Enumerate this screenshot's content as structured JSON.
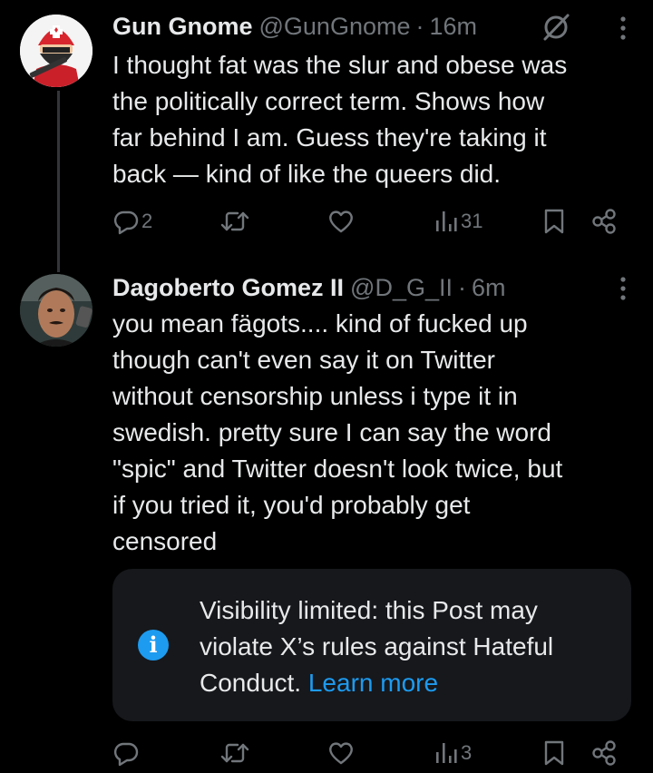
{
  "post1": {
    "name": "Gun Gnome",
    "handle": "@GunGnome",
    "separator": "·",
    "time": "16m",
    "icon_mute": "muted-conversation-icon",
    "icon_more": "more-options-icon",
    "lines": [
      "I thought fat was the slur and obese was",
      "the politically correct term. Shows how",
      "far behind I am. Guess they're taking it",
      "back — kind of like the queers did."
    ],
    "actions": {
      "reply_count": "2",
      "retweet_count": "",
      "like_count": "",
      "views_count": "31"
    }
  },
  "post2": {
    "name": "Dagoberto Gomez II",
    "handle": "@D_G_II",
    "separator": "·",
    "time": "6m",
    "icon_more": "more-options-icon",
    "lines": [
      "you mean fägots.... kind of fucked up",
      "though can't even say it on Twitter",
      "without censorship unless i type it in",
      "swedish. pretty sure I can say the word",
      "\"spic\" and Twitter doesn't look twice, but",
      "if you tried it, you'd probably get",
      "censored"
    ],
    "notice": {
      "icon": "info-icon",
      "icon_glyph": "i",
      "line1": "Visibility limited: this Post may",
      "line2": "violate X’s rules against Hateful",
      "line3_prefix": "Conduct. ",
      "link": "Learn more"
    },
    "actions": {
      "reply_count": "",
      "retweet_count": "",
      "like_count": "",
      "views_count": "3"
    }
  },
  "colors": {
    "background": "#000000",
    "text": "#e7e9ea",
    "secondary": "#71767b",
    "accent": "#1d9bf0",
    "card": "#16181c"
  }
}
